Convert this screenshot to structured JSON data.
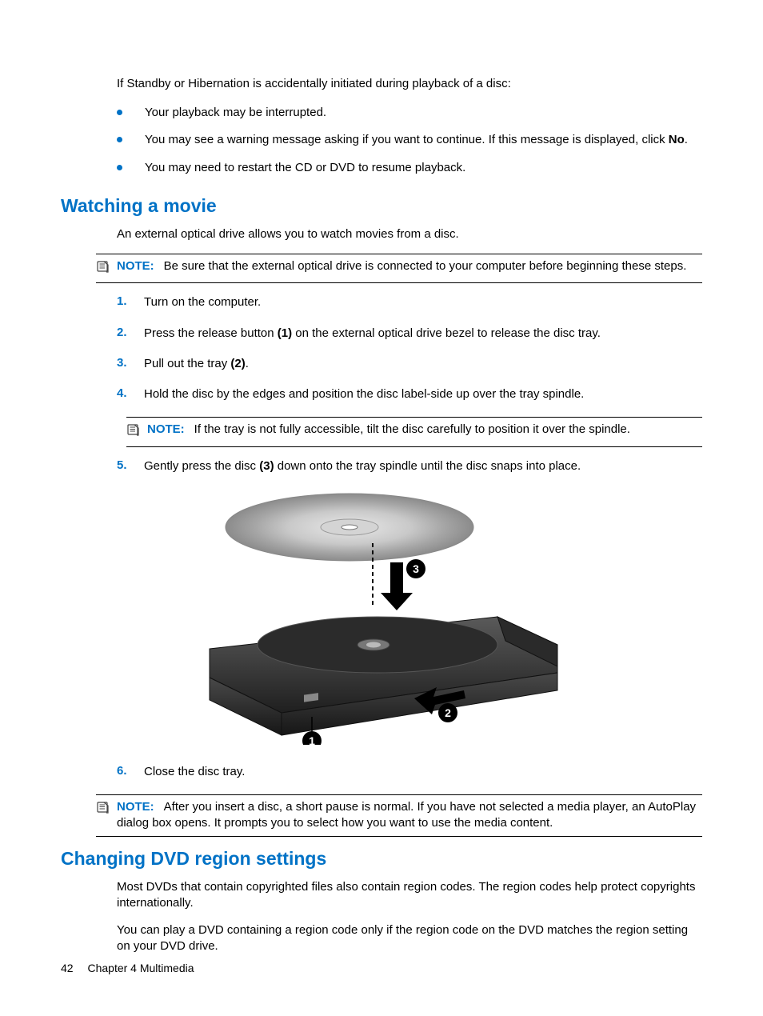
{
  "intro": "If Standby or Hibernation is accidentally initiated during playback of a disc:",
  "bullets": [
    "Your playback may be interrupted.",
    "You may see a warning message asking if you want to continue. If this message is displayed, click ",
    "You may need to restart the CD or DVD to resume playback."
  ],
  "bullet2_bold": "No",
  "bullet2_tail": ".",
  "section1": {
    "title": "Watching a movie",
    "para": "An external optical drive allows you to watch movies from a disc.",
    "note1_label": "NOTE:",
    "note1_text": "Be sure that the external optical drive is connected to your computer before beginning these steps.",
    "step1": "Turn on the computer.",
    "step2_a": "Press the release button ",
    "step2_b": "(1)",
    "step2_c": " on the external optical drive bezel to release the disc tray.",
    "step3_a": "Pull out the tray ",
    "step3_b": "(2)",
    "step3_c": ".",
    "step4": "Hold the disc by the edges and position the disc label-side up over the tray spindle.",
    "note2_label": "NOTE:",
    "note2_text": "If the tray is not fully accessible, tilt the disc carefully to position it over the spindle.",
    "step5_a": "Gently press the disc ",
    "step5_b": "(3)",
    "step5_c": " down onto the tray spindle until the disc snaps into place.",
    "step6": "Close the disc tray.",
    "note3_label": "NOTE:",
    "note3_text": "After you insert a disc, a short pause is normal. If you have not selected a media player, an AutoPlay dialog box opens. It prompts you to select how you want to use the media content."
  },
  "section2": {
    "title": "Changing DVD region settings",
    "para1": "Most DVDs that contain copyrighted files also contain region codes. The region codes help protect copyrights internationally.",
    "para2": "You can play a DVD containing a region code only if the region code on the DVD matches the region setting on your DVD drive."
  },
  "footer": {
    "page": "42",
    "chapter": "Chapter 4   Multimedia"
  },
  "step_nums": [
    "1.",
    "2.",
    "3.",
    "4.",
    "5.",
    "6."
  ]
}
